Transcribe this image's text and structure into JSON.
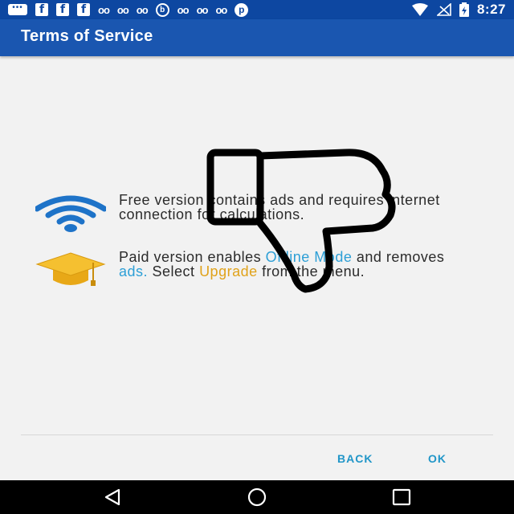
{
  "status_bar": {
    "time": "8:27",
    "left_icons": [
      "chat-icon",
      "facebook-icon",
      "facebook-icon",
      "facebook-icon",
      "infinity-icon",
      "infinity-icon",
      "infinity-icon",
      "b-circle-icon",
      "infinity-icon",
      "infinity-icon",
      "infinity-icon",
      "pinterest-icon"
    ],
    "right_icons": [
      "wifi-icon",
      "no-signal-icon",
      "battery-charging-icon"
    ]
  },
  "app_bar": {
    "title": "Terms of Service"
  },
  "content": {
    "free_version_text": "Free version contains ads and requires internet connection for calculations.",
    "paid_parts": {
      "p1": "Paid version enables ",
      "offline_mode": "Offline Mode",
      "p2": " and removes ",
      "ads": "ads.",
      "p3": " Select ",
      "upgrade": "Upgrade",
      "p4": " from the menu."
    },
    "icons": {
      "free": "wifi-icon",
      "paid": "graduation-cap-icon",
      "overlay": "thumbs-down-icon"
    },
    "colors": {
      "link_blue": "#2d9fd6",
      "link_gold": "#e0a21a",
      "app_bar": "#1a56b0"
    }
  },
  "dialog_buttons": {
    "back_label": "BACK",
    "ok_label": "OK"
  },
  "nav_bar": {
    "icons": [
      "back-triangle-icon",
      "home-circle-icon",
      "recents-square-icon"
    ]
  }
}
